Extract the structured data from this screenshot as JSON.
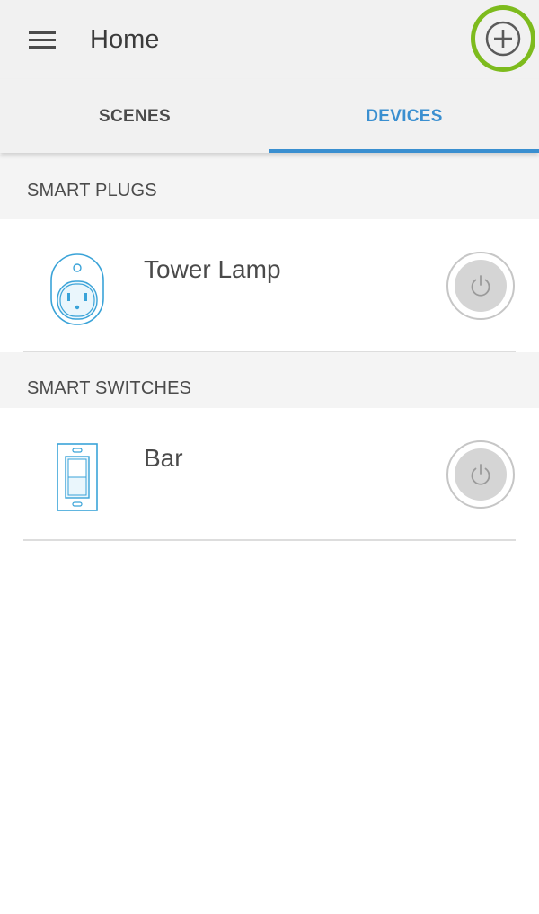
{
  "header": {
    "title": "Home",
    "menu_icon": "hamburger-menu-icon",
    "add_icon": "add-circle-icon",
    "add_highlight_color": "#7dbb1d"
  },
  "tabs": [
    {
      "label": "SCENES",
      "active": false
    },
    {
      "label": "DEVICES",
      "active": true
    }
  ],
  "accent_color": "#3a8fd0",
  "sections": [
    {
      "title": "SMART PLUGS",
      "devices": [
        {
          "name": "Tower Lamp",
          "icon": "smart-plug-icon",
          "power_icon": "power-icon"
        }
      ]
    },
    {
      "title": "SMART SWITCHES",
      "devices": [
        {
          "name": "Bar",
          "icon": "light-switch-icon",
          "power_icon": "power-icon"
        }
      ]
    }
  ]
}
